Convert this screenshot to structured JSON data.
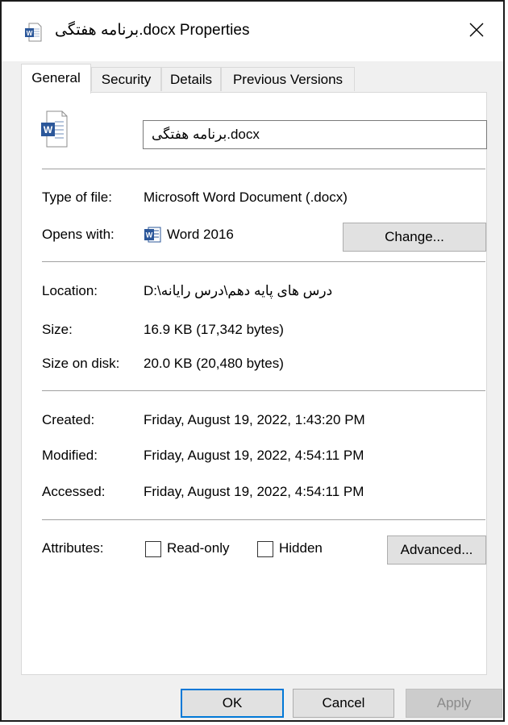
{
  "window": {
    "title": "برنامه هفتگی.docx Properties",
    "close_glyph": "✕"
  },
  "tabs": [
    {
      "label": "General",
      "active": true
    },
    {
      "label": "Security",
      "active": false
    },
    {
      "label": "Details",
      "active": false
    },
    {
      "label": "Previous Versions",
      "active": false
    }
  ],
  "general": {
    "file_name": "برنامه هفتگی.docx",
    "type_label": "Type of file:",
    "type_value": "Microsoft Word Document (.docx)",
    "opens_label": "Opens with:",
    "opens_value": "Word 2016",
    "change_button": "Change...",
    "location_label": "Location:",
    "location_value": "D:\\درس های پایه دهم\\درس رایانه",
    "size_label": "Size:",
    "size_value": "16.9 KB (17,342 bytes)",
    "size_disk_label": "Size on disk:",
    "size_disk_value": "20.0 KB (20,480 bytes)",
    "created_label": "Created:",
    "created_value": "Friday, August 19, 2022, 1:43:20 PM",
    "modified_label": "Modified:",
    "modified_value": "Friday, August 19, 2022, 4:54:11 PM",
    "accessed_label": "Accessed:",
    "accessed_value": "Friday, August 19, 2022, 4:54:11 PM",
    "attributes_label": "Attributes:",
    "readonly_label": "Read-only",
    "readonly_checked": false,
    "hidden_label": "Hidden",
    "hidden_checked": false,
    "advanced_button": "Advanced..."
  },
  "footer": {
    "ok": "OK",
    "cancel": "Cancel",
    "apply": "Apply"
  },
  "colors": {
    "word_blue": "#2b579a",
    "focus_blue": "#0078d7",
    "panel_bg": "#ffffff",
    "window_bg": "#f0f0f0"
  },
  "icons": {
    "title": "word-document-icon",
    "file": "word-document-icon",
    "opens": "word-app-icon",
    "close": "close-icon"
  }
}
